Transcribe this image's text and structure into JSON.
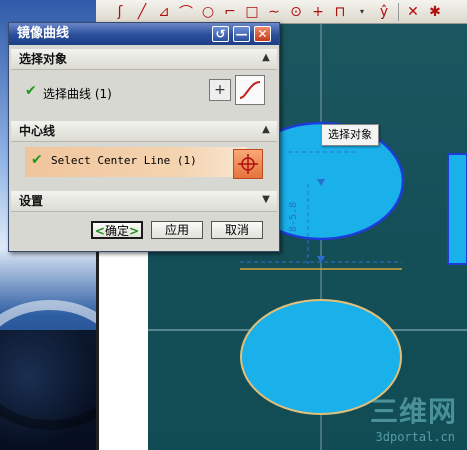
{
  "dialog": {
    "title": "镜像曲线",
    "sections": {
      "select_object": {
        "header": "选择对象",
        "row_label": "选择曲线 (1)"
      },
      "center_line": {
        "header": "中心线",
        "row_label": "Select Center Line (1)"
      },
      "settings": {
        "header": "设置"
      }
    },
    "buttons": {
      "ok": "确定",
      "apply": "应用",
      "cancel": "取消"
    }
  },
  "graphics": {
    "tooltip": "选择对象",
    "dimension_label": "8-5.8",
    "watermark": {
      "title": "三维网",
      "url": "3dportal.cn"
    }
  },
  "colors": {
    "title_bar": "#2a4e9a",
    "ellipse_fill": "#1ab0ea",
    "check_green": "#1e9a1e",
    "center_row": "#f0c59c"
  }
}
